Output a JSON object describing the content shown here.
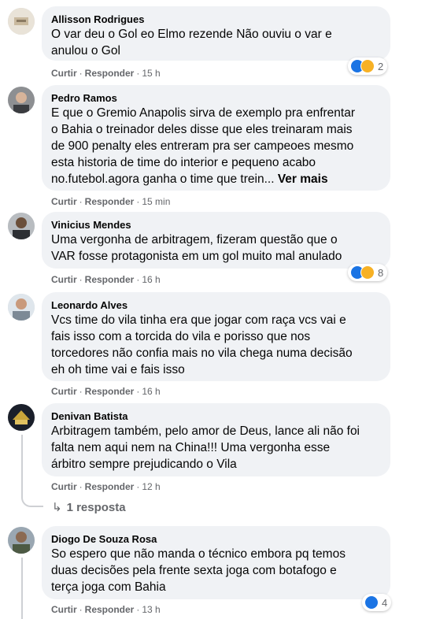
{
  "comments": [
    {
      "author": "Allisson Rodrigues",
      "text": "O var deu o Gol eo Elmo rezende Não ouviu o var e\nanulou o Gol",
      "like": "Curtir",
      "reply": "Responder",
      "time": "15 h",
      "reactions": {
        "types": [
          "like-icon",
          "haha-icon"
        ],
        "count": "2"
      }
    },
    {
      "author": "Pedro Ramos",
      "text": "E que o Gremio Anapolis sirva de exemplo pra enfrentar\no Bahia o treinador deles disse que eles treinaram mais\nde 900 penalty eles entreram pra ser campeoes mesmo\nesta historia de time do interior e pequeno acabo\nno.futebol.agora ganha o time que trein... ",
      "see_more": "Ver mais",
      "like": "Curtir",
      "reply": "Responder",
      "time": "15 min"
    },
    {
      "author": "Vinicius Mendes",
      "text": "Uma vergonha de arbitragem, fizeram questão que o\nVAR fosse protagonista em um gol muito mal anulado",
      "like": "Curtir",
      "reply": "Responder",
      "time": "16 h",
      "reactions": {
        "types": [
          "like-icon",
          "haha-icon"
        ],
        "count": "8"
      }
    },
    {
      "author": "Leonardo Alves",
      "text": "Vcs time do vila tinha era que jogar com raça vcs vai e\nfais isso com a torcida do vila e porisso que nos\ntorcedores não confia mais no vila chega numa decisão\neh oh time vai e fais isso",
      "like": "Curtir",
      "reply": "Responder",
      "time": "16 h"
    },
    {
      "author": "Denivan Batista",
      "text": "Arbitragem também, pelo amor de Deus, lance ali não foi\nfalta nem aqui nem na China!!! Uma vergonha esse\nárbitro sempre prejudicando o Vila",
      "like": "Curtir",
      "reply": "Responder",
      "time": "12 h",
      "replies_label": "1 resposta"
    },
    {
      "author": "Diogo De Souza Rosa",
      "text": "So espero que não manda o técnico embora pq temos\nduas decisões pela frente sexta joga com botafogo e\nterça joga com Bahia",
      "like": "Curtir",
      "reply": "Responder",
      "time": "13 h",
      "reactions": {
        "types": [
          "like-icon"
        ],
        "count": "4"
      }
    }
  ],
  "separator": "·",
  "colors": {
    "bubble": "#f0f2f5",
    "meta": "#65676b",
    "like_blue": "#1b74e4",
    "haha_yellow": "#f7b125"
  }
}
